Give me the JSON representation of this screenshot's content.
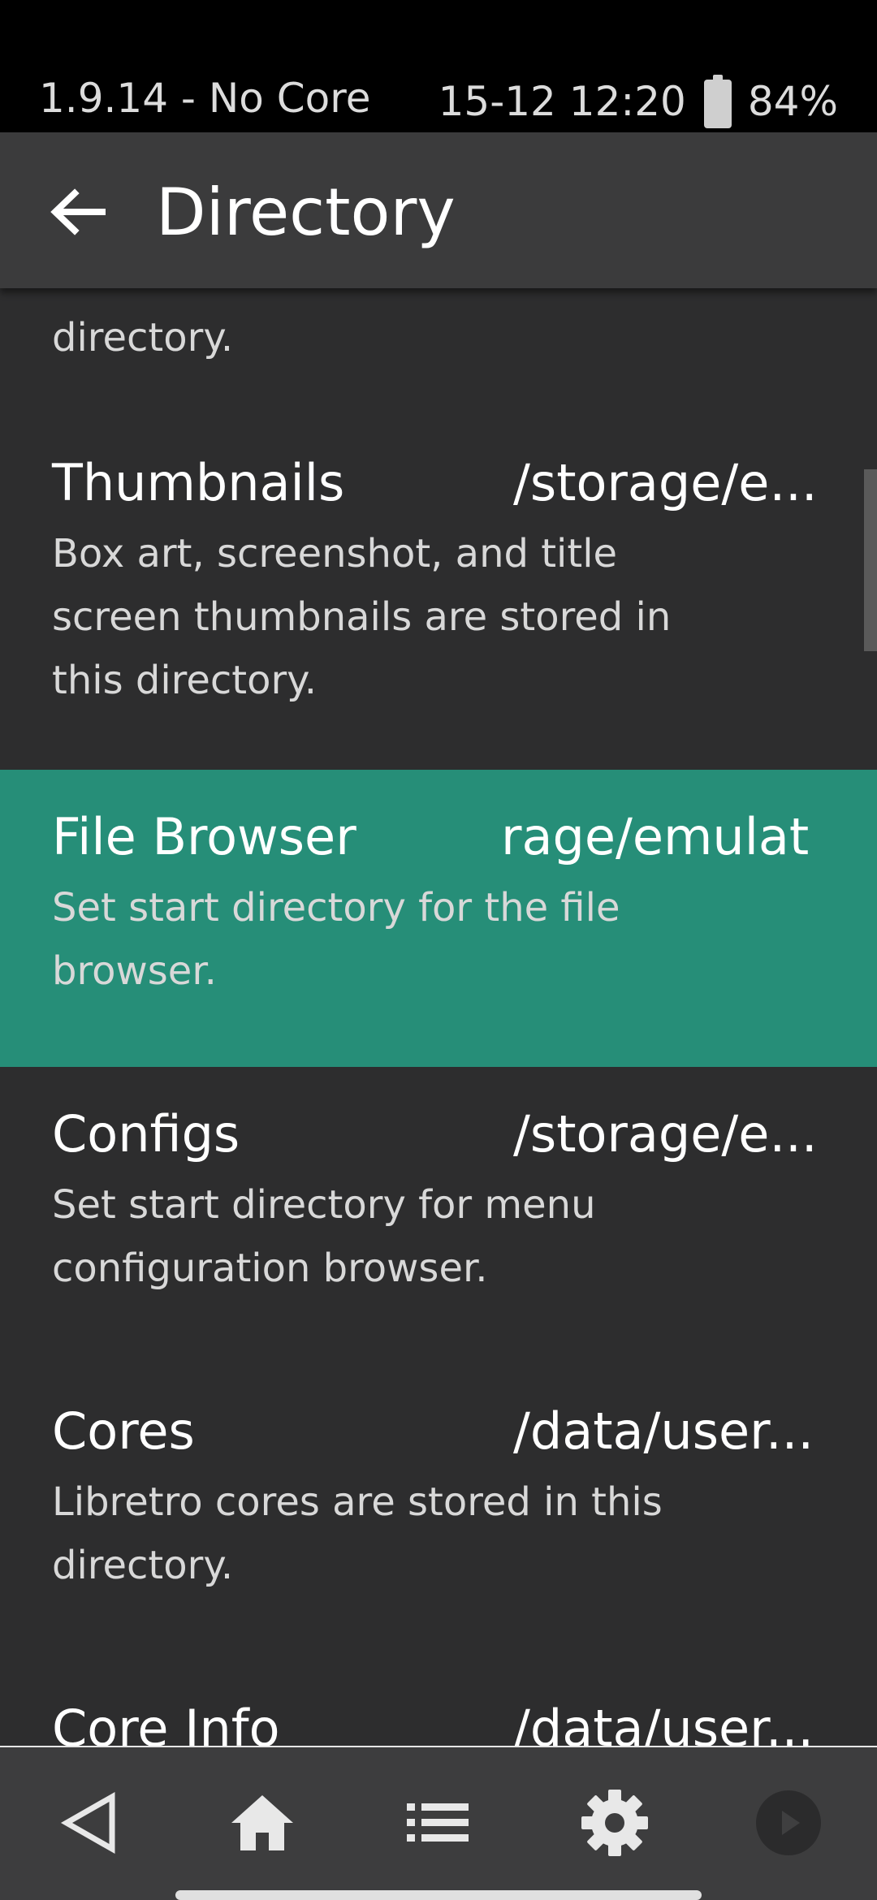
{
  "status_bar": {
    "left_text": "1.9.14 - No Core",
    "time": "15-12 12:20",
    "battery": "84%"
  },
  "header": {
    "title": "Directory",
    "back_icon": "arrow-left-icon"
  },
  "list": {
    "partial_description": "directory.",
    "items": [
      {
        "title": "Thumbnails",
        "value": "/storage/e...",
        "description": [
          "Box art, screenshot, and title",
          "screen thumbnails are stored in",
          "this directory."
        ]
      },
      {
        "title": "File Browser",
        "value": "rage/emulat",
        "description": [
          "Set start directory for the file",
          "browser."
        ],
        "selected": true
      },
      {
        "title": "Configs",
        "value": "/storage/e...",
        "description": [
          "Set start directory for menu",
          "configuration browser."
        ]
      },
      {
        "title": "Cores",
        "value": "/data/user...",
        "description": [
          "Libretro cores are stored in this",
          "directory."
        ]
      },
      {
        "title": "Core Info",
        "value": "/data/user..."
      }
    ]
  },
  "bottom_nav": {
    "items": [
      "back-triangle-icon",
      "home-icon",
      "list-icon",
      "gear-icon",
      "play-icon"
    ]
  },
  "colors": {
    "background": "#2d2d2e",
    "app_bar": "#3b3b3c",
    "selected_row": "#268e78",
    "bottom_nav": "#3d3d3e"
  }
}
